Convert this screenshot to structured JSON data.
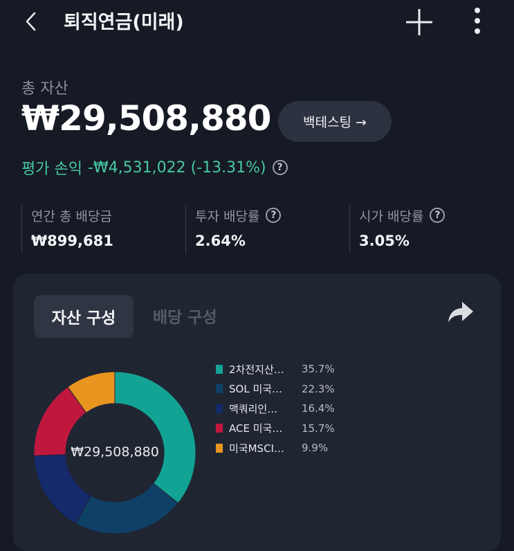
{
  "header": {
    "title": "퇴직연금(미래)"
  },
  "summary": {
    "assets_label": "총 자산",
    "total_amount": "₩29,508,880",
    "backtest_label": "백테스팅 →",
    "pnl_label": "평가 손익",
    "pnl_value": "-₩4,531,022 (-13.31%)"
  },
  "stats": [
    {
      "label": "연간 총 배당금",
      "value": "₩899,681",
      "help": false
    },
    {
      "label": "투자 배당률",
      "value": "2.64%",
      "help": true
    },
    {
      "label": "시가 배당률",
      "value": "3.05%",
      "help": true
    }
  ],
  "tabs": {
    "assets": "자산 구성",
    "dividend": "배당 구성"
  },
  "chart_data": {
    "type": "pie",
    "center_label": "₩29,508,880",
    "slices": [
      {
        "name": "2차전지산…",
        "percent_label": "35.7%",
        "value": 35.7,
        "color": "#12a394"
      },
      {
        "name": "SOL 미국…",
        "percent_label": "22.3%",
        "value": 22.3,
        "color": "#0e4068"
      },
      {
        "name": "맥쿼리인…",
        "percent_label": "16.4%",
        "value": 16.4,
        "color": "#152a6b"
      },
      {
        "name": "ACE 미국…",
        "percent_label": "15.7%",
        "value": 15.7,
        "color": "#c0173e"
      },
      {
        "name": "미국MSCI…",
        "percent_label": "9.9%",
        "value": 9.9,
        "color": "#e8951f"
      }
    ]
  }
}
